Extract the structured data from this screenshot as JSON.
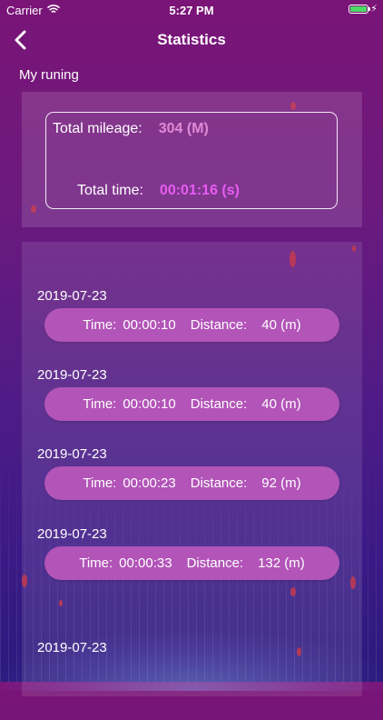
{
  "status_bar": {
    "carrier": "Carrier",
    "time": "5:27 PM",
    "battery_icon": "battery-full-icon",
    "wifi_icon": "wifi-icon"
  },
  "nav": {
    "title": "Statistics",
    "back_icon": "chevron-left-icon"
  },
  "section_label": "My runing",
  "summary": {
    "mileage_label": "Total mileage:",
    "mileage_value": "304  (M)",
    "time_label": "Total time:",
    "time_value": "00:01:16  (s)"
  },
  "records": [
    {
      "date": "2019-07-23",
      "time_label": "Time:",
      "time": "00:00:10",
      "distance_label": "Distance:",
      "distance": "40 (m)"
    },
    {
      "date": "2019-07-23",
      "time_label": "Time:",
      "time": "00:00:10",
      "distance_label": "Distance:",
      "distance": "40 (m)"
    },
    {
      "date": "2019-07-23",
      "time_label": "Time:",
      "time": "00:00:23",
      "distance_label": "Distance:",
      "distance": "92 (m)"
    },
    {
      "date": "2019-07-23",
      "time_label": "Time:",
      "time": "00:00:33",
      "distance_label": "Distance:",
      "distance": "132 (m)"
    },
    {
      "date": "2019-07-23"
    }
  ],
  "colors": {
    "background_top": "#7a1477",
    "background_bottom": "#2a1a7c",
    "pill": "#b254b8",
    "mileage_value": "#e08ad6",
    "time_value": "#e85cf2",
    "battery": "#4cd964"
  }
}
